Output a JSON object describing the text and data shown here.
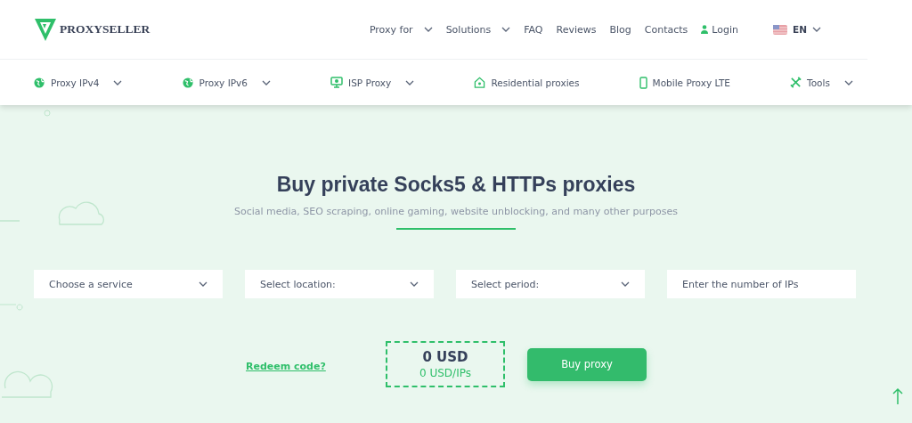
{
  "header": {
    "logo_text": "PROXYSELLER",
    "nav": [
      {
        "label": "Proxy for",
        "kind": "dropdown"
      },
      {
        "label": "Solutions",
        "kind": "dropdown"
      },
      {
        "label": "FAQ",
        "kind": "link"
      },
      {
        "label": "Reviews",
        "kind": "link"
      },
      {
        "label": "Blog",
        "kind": "link"
      },
      {
        "label": "Contacts",
        "kind": "link"
      },
      {
        "label": "Login",
        "kind": "login"
      }
    ],
    "language": "EN"
  },
  "subnav": [
    {
      "label": "Proxy IPv4",
      "kind": "globe",
      "dropdown": true
    },
    {
      "label": "Proxy IPv6",
      "kind": "globe",
      "dropdown": true
    },
    {
      "label": "ISP Proxy",
      "kind": "monitor",
      "dropdown": true
    },
    {
      "label": "Residential proxies",
      "kind": "house",
      "dropdown": false
    },
    {
      "label": "Mobile Proxy LTE",
      "kind": "phone",
      "dropdown": false
    },
    {
      "label": "Tools",
      "kind": "tools",
      "dropdown": true
    }
  ],
  "hero": {
    "title": "Buy private Socks5 & HTTPs proxies",
    "subtitle": "Social media, SEO scraping, online gaming, website unblocking, and many other purposes"
  },
  "form": {
    "fields": [
      {
        "kind": "select",
        "placeholder": "Choose a service"
      },
      {
        "kind": "select",
        "placeholder": "Select location:"
      },
      {
        "kind": "select",
        "placeholder": "Select period:"
      },
      {
        "kind": "input",
        "placeholder": "Enter the number of IPs"
      }
    ],
    "redeem_link": "Redeem code?",
    "total": "0 USD",
    "per_ip": "0 USD/IPs",
    "buy_button": "Buy proxy"
  }
}
